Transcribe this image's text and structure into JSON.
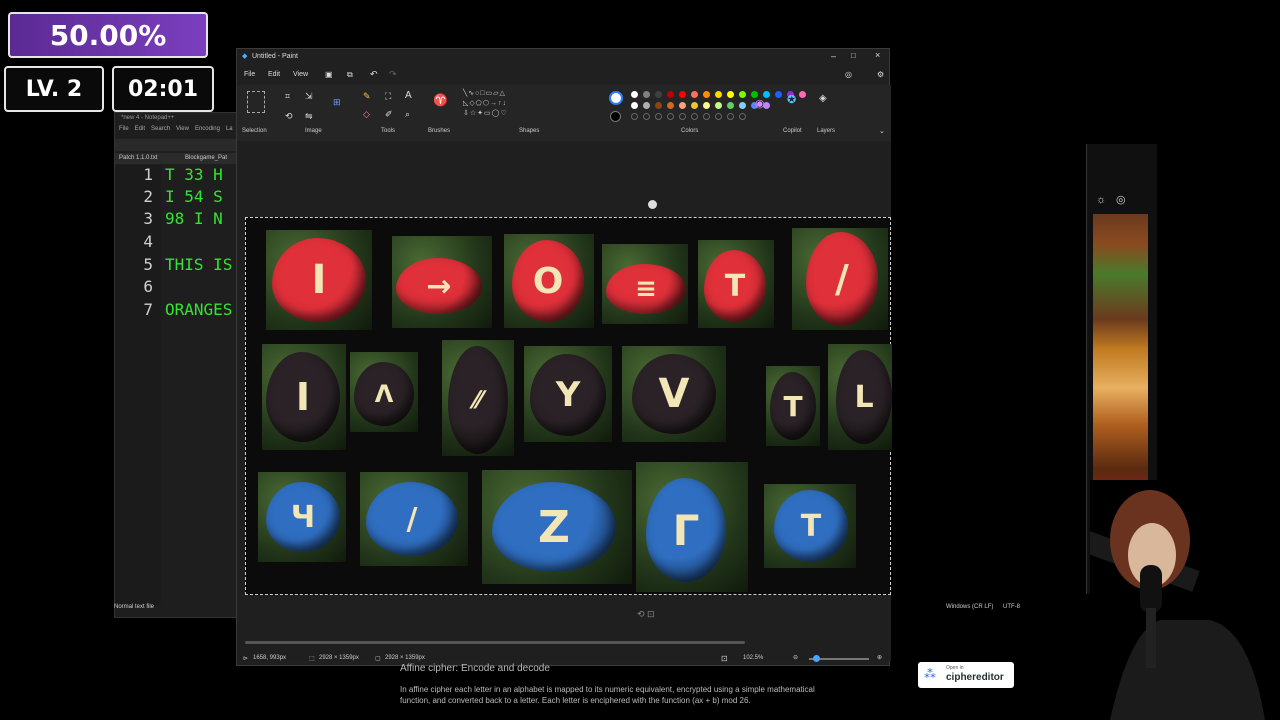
{
  "overlay": {
    "progress": "50.00%",
    "level": "LV. 2",
    "timer": "02:01"
  },
  "notepad": {
    "title": "*new 4 - Notepad++",
    "menu": [
      "File",
      "Edit",
      "Search",
      "View",
      "Encoding",
      "La"
    ],
    "tabs": [
      "Patch 1.1.0.txt",
      "Blockgame_Pat"
    ],
    "lines": [
      {
        "num": "1",
        "text": "T 33 H"
      },
      {
        "num": "2",
        "text": "I 54 S"
      },
      {
        "num": "3",
        "text": "98 I N"
      },
      {
        "num": "4",
        "text": ""
      },
      {
        "num": "5",
        "text": "THIS IS"
      },
      {
        "num": "6",
        "text": ""
      },
      {
        "num": "7",
        "text": "ORANGES"
      }
    ],
    "status": "Normal text file",
    "status_right": [
      "Windows (CR LF)",
      "UTF-8"
    ]
  },
  "paint": {
    "title": "Untitled - Paint",
    "menu": [
      "File",
      "Edit",
      "View"
    ],
    "groups": [
      "Selection",
      "Image",
      "Tools",
      "Brushes",
      "Shapes",
      "Colors",
      "Copilot",
      "Layers"
    ],
    "status": {
      "cursor": "1658, 993px",
      "selection": "2928 × 1359px",
      "canvas": "2928 × 1359px",
      "zoom": "102.5%"
    },
    "palette": [
      "#ffffff",
      "#808080",
      "#404040",
      "#c00000",
      "#ff0000",
      "#ff6f61",
      "#ff8c00",
      "#ffd700",
      "#ffff00",
      "#7cfc00",
      "#00c000",
      "#00bfff",
      "#1e5fff",
      "#8a2be2",
      "#ff69b4"
    ],
    "palette_row2": [
      "#ffffff",
      "#b0b0b0",
      "#8b4513",
      "#d2691e",
      "#ffa07a",
      "#f4c430",
      "#fff68f",
      "#c0ff80",
      "#60d060",
      "#80d0ff",
      "#6080ff",
      "#c080ff"
    ]
  },
  "rocks": [
    {
      "color": "#e0303a",
      "glyph": "I"
    },
    {
      "color": "#e0303a",
      "glyph": "→"
    },
    {
      "color": "#e0303a",
      "glyph": "O"
    },
    {
      "color": "#e0303a",
      "glyph": "≡"
    },
    {
      "color": "#e0303a",
      "glyph": "T"
    },
    {
      "color": "#e0303a",
      "glyph": "/"
    },
    {
      "color": "#2a2226",
      "glyph": "I"
    },
    {
      "color": "#2a2226",
      "glyph": "Λ"
    },
    {
      "color": "#2a2226",
      "glyph": "⁄⁄"
    },
    {
      "color": "#2a2226",
      "glyph": "Y"
    },
    {
      "color": "#2a2226",
      "glyph": "V"
    },
    {
      "color": "#2a2226",
      "glyph": "T"
    },
    {
      "color": "#2a2226",
      "glyph": "L"
    },
    {
      "color": "#2f6ec0",
      "glyph": "Ч"
    },
    {
      "color": "#2f6ec0",
      "glyph": "/"
    },
    {
      "color": "#2f6ec0",
      "glyph": "Z"
    },
    {
      "color": "#2f6ec0",
      "glyph": "Γ"
    },
    {
      "color": "#2f6ec0",
      "glyph": "T"
    }
  ],
  "cipher": {
    "title": "Affine cipher: Encode and decode",
    "body": "In affine cipher each letter in an alphabet is mapped to its numeric equivalent, encrypted using a simple mathematical function, and converted back to a letter. Each letter is enciphered with the function (ax + b) mod 26.",
    "open_small": "Open in",
    "open_big": "ciphereditor"
  }
}
